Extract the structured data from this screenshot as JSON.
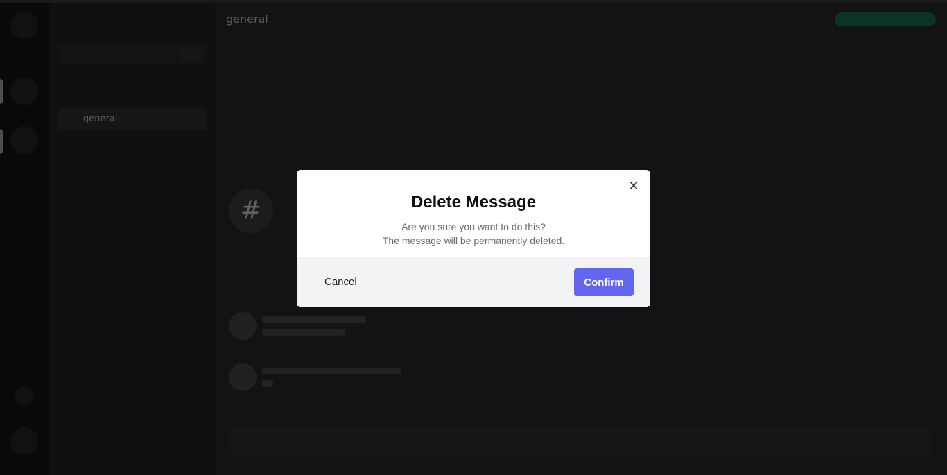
{
  "background": {
    "channel_name": "general"
  },
  "dialog": {
    "title": "Delete Message",
    "description_line1": "Are you sure you want to do this?",
    "description_line2": "The message will be permanently deleted.",
    "close_symbol": "✕",
    "cancel_label": "Cancel",
    "confirm_label": "Confirm",
    "confirm_color": "#6366f1"
  }
}
